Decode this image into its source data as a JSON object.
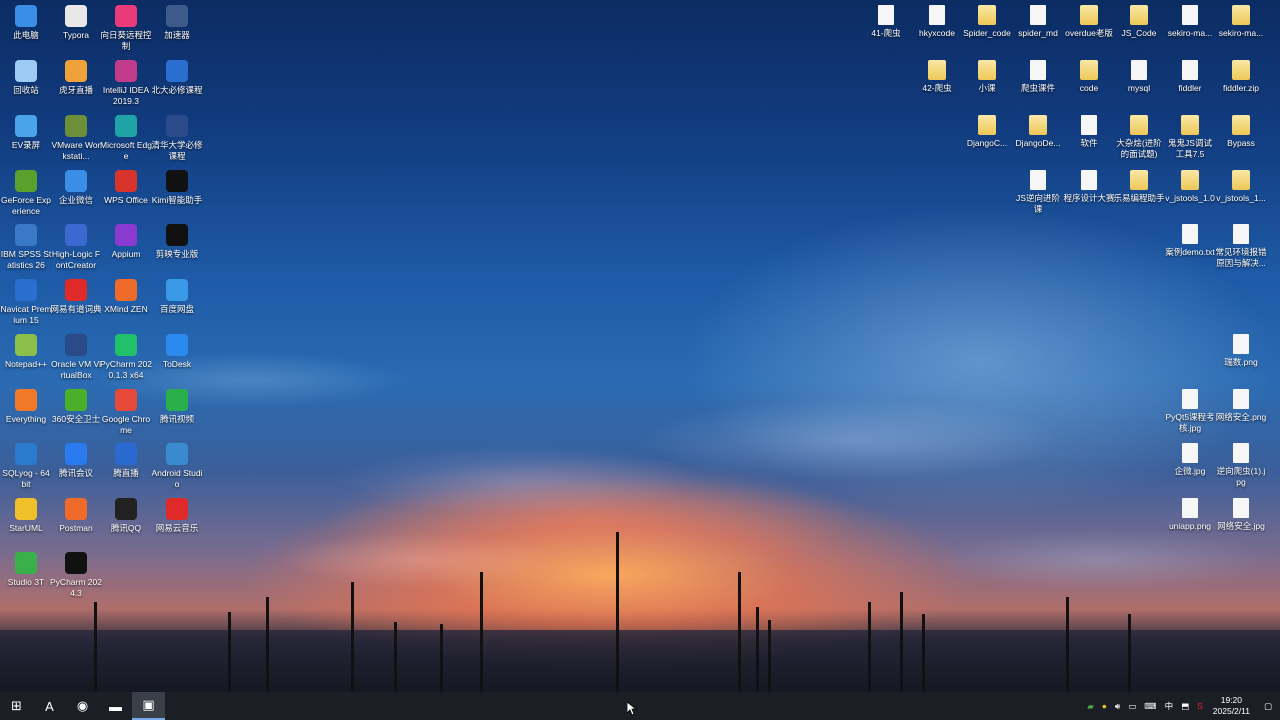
{
  "left_icons": [
    {
      "label": "此电脑",
      "icon": "computer-icon",
      "color": "#3a8ee6"
    },
    {
      "label": "Typora",
      "icon": "typora-icon",
      "color": "#e8e8e8"
    },
    {
      "label": "向日葵远程控制",
      "icon": "sunlogin-icon",
      "color": "#e93a7a"
    },
    {
      "label": "加速器",
      "icon": "accelerator-icon",
      "color": "#3e5a8a"
    },
    {
      "label": "回收站",
      "icon": "recycle-bin-icon",
      "color": "#9ecbf5"
    },
    {
      "label": "虎牙直播",
      "icon": "huya-icon",
      "color": "#f0a23a"
    },
    {
      "label": "IntelliJ IDEA 2019.3",
      "icon": "intellij-icon",
      "color": "#c23a8c"
    },
    {
      "label": "北大必修课程",
      "icon": "course-icon",
      "color": "#2a6fd0"
    },
    {
      "label": "EV录屏",
      "icon": "ev-recorder-icon",
      "color": "#4aa4ea"
    },
    {
      "label": "VMware Workstati...",
      "icon": "vmware-icon",
      "color": "#6e8f3a"
    },
    {
      "label": "Microsoft Edge",
      "icon": "edge-icon",
      "color": "#1fa3a6"
    },
    {
      "label": "清华大学必修课程",
      "icon": "course-icon",
      "color": "#2a4a8a"
    },
    {
      "label": "GeForce Experience",
      "icon": "geforce-icon",
      "color": "#5aa02c"
    },
    {
      "label": "企业微信",
      "icon": "wecom-icon",
      "color": "#3a8ee6"
    },
    {
      "label": "WPS Office",
      "icon": "wps-icon",
      "color": "#d9342b"
    },
    {
      "label": "Kimi智能助手",
      "icon": "kimi-icon",
      "color": "#111111"
    },
    {
      "label": "IBM SPSS Statistics 26",
      "icon": "spss-icon",
      "color": "#3a78c8"
    },
    {
      "label": "High-Logic FontCreator",
      "icon": "fontcreator-icon",
      "color": "#3a6ad0"
    },
    {
      "label": "Appium",
      "icon": "appium-icon",
      "color": "#8a3ad0"
    },
    {
      "label": "剪映专业版",
      "icon": "capcut-icon",
      "color": "#111111"
    },
    {
      "label": "Navicat Premium 15",
      "icon": "navicat-icon",
      "color": "#2a6fd0"
    },
    {
      "label": "网易有道词典",
      "icon": "youdao-icon",
      "color": "#e02a2a"
    },
    {
      "label": "XMind ZEN",
      "icon": "xmind-icon",
      "color": "#f06a2a"
    },
    {
      "label": "百度网盘",
      "icon": "baidu-netdisk-icon",
      "color": "#3a9ae8"
    },
    {
      "label": "Notepad++",
      "icon": "notepadpp-icon",
      "color": "#8ac04a"
    },
    {
      "label": "Oracle VM VirtualBox",
      "icon": "virtualbox-icon",
      "color": "#2a4a8a"
    },
    {
      "label": "PyCharm 2020.1.3 x64",
      "icon": "pycharm-icon",
      "color": "#21c06a"
    },
    {
      "label": "ToDesk",
      "icon": "todesk-icon",
      "color": "#2a8af0"
    },
    {
      "label": "Everything",
      "icon": "everything-icon",
      "color": "#f07a2a"
    },
    {
      "label": "360安全卫士",
      "icon": "360-icon",
      "color": "#4ab02a"
    },
    {
      "label": "Google Chrome",
      "icon": "chrome-icon",
      "color": "#e84a3a"
    },
    {
      "label": "腾讯视频",
      "icon": "tencent-video-icon",
      "color": "#2ab04a"
    },
    {
      "label": "SQLyog - 64 bit",
      "icon": "sqlyog-icon",
      "color": "#2a7ad0"
    },
    {
      "label": "腾讯会议",
      "icon": "tencent-meeting-icon",
      "color": "#2a7af0"
    },
    {
      "label": "腾直播",
      "icon": "live-icon",
      "color": "#2a6ad0"
    },
    {
      "label": "Android Studio",
      "icon": "android-studio-icon",
      "color": "#3a8ad0"
    },
    {
      "label": "StarUML",
      "icon": "staruml-icon",
      "color": "#f0c02a"
    },
    {
      "label": "Postman",
      "icon": "postman-icon",
      "color": "#f06a2a"
    },
    {
      "label": "腾讯QQ",
      "icon": "qq-icon",
      "color": "#222222"
    },
    {
      "label": "网易云音乐",
      "icon": "netease-music-icon",
      "color": "#e02a2a"
    },
    {
      "label": "Studio 3T",
      "icon": "studio3t-icon",
      "color": "#3ab04a"
    },
    {
      "label": "PyCharm 2024.3",
      "icon": "pycharm-icon",
      "color": "#111111"
    }
  ],
  "right_icons": [
    {
      "label": "41-爬虫",
      "type": "file"
    },
    {
      "label": "hkyxcode",
      "type": "file"
    },
    {
      "label": "Spider_code",
      "type": "folder"
    },
    {
      "label": "spider_md",
      "type": "file"
    },
    {
      "label": "overdue老版",
      "type": "folder"
    },
    {
      "label": "JS_Code",
      "type": "folder"
    },
    {
      "label": "sekiro-ma...",
      "type": "file"
    },
    {
      "label": "sekiro-ma...",
      "type": "folder"
    },
    {
      "label": "42-爬虫",
      "type": "folder"
    },
    {
      "label": "小课",
      "type": "folder"
    },
    {
      "label": "爬虫课件",
      "type": "file"
    },
    {
      "label": "code",
      "type": "folder"
    },
    {
      "label": "mysql",
      "type": "file"
    },
    {
      "label": "fiddler",
      "type": "file"
    },
    {
      "label": "fiddler.zip",
      "type": "folder"
    },
    {
      "label": "DjangoC...",
      "type": "folder"
    },
    {
      "label": "DjangoDe...",
      "type": "folder"
    },
    {
      "label": "软件",
      "type": "file"
    },
    {
      "label": "大杂烩(进阶的面试题)",
      "type": "folder"
    },
    {
      "label": "鬼鬼JS调试工具7.5",
      "type": "folder"
    },
    {
      "label": "Bypass",
      "type": "folder"
    },
    {
      "label": "JS逆向进阶课",
      "type": "file"
    },
    {
      "label": "程序设计大赛",
      "type": "file"
    },
    {
      "label": "乐易编程助手",
      "type": "folder"
    },
    {
      "label": "v_jstools_1.0",
      "type": "folder"
    },
    {
      "label": "v_jstools_1...",
      "type": "folder"
    },
    {
      "label": "案例demo.txt",
      "type": "file"
    },
    {
      "label": "常见环境报错原因与解决...",
      "type": "file"
    },
    {
      "label": "瑞数.png",
      "type": "file"
    },
    {
      "label": "PyQt5课程考核.jpg",
      "type": "file"
    },
    {
      "label": "网络安全.png",
      "type": "file"
    },
    {
      "label": "企微.jpg",
      "type": "file"
    },
    {
      "label": "逆向爬虫(1).jpg",
      "type": "file"
    },
    {
      "label": "uniapp.png",
      "type": "file"
    },
    {
      "label": "网络安全.jpg",
      "type": "file"
    }
  ],
  "taskbar": {
    "start": "⊞",
    "apps": [
      {
        "name": "app-store-icon",
        "glyph": "A",
        "active": false
      },
      {
        "name": "chrome-taskbar-icon",
        "glyph": "◉",
        "active": false
      },
      {
        "name": "file-explorer-icon",
        "glyph": "▬",
        "active": false
      },
      {
        "name": "screen-recorder-icon",
        "glyph": "▣",
        "active": true
      }
    ],
    "tray_ime": "中",
    "time": "19:20",
    "date": "2025/2/11"
  }
}
